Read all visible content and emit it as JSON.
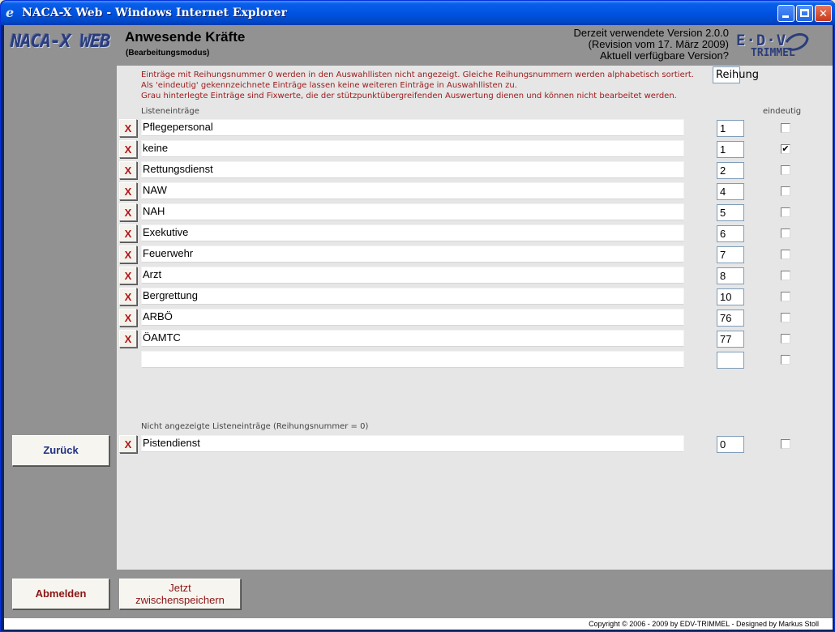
{
  "window": {
    "title": "NACA-X Web - Windows Internet Explorer",
    "icon": "ie-icon"
  },
  "header": {
    "logo": "NACA-X WEB",
    "title": "Anwesende Kräfte",
    "subtitle": "(Bearbeitungsmodus)",
    "version_line1": "Derzeit verwendete Version 2.0.0",
    "version_line2": "(Revision vom 17. März 2009)",
    "version_line3": "Aktuell verfügbare Version?",
    "brand_main": "E·D·V",
    "brand_sub": "TRIMMEL"
  },
  "info": {
    "line1": "Einträge mit Reihungsnummer 0 werden in den Auswahllisten nicht angezeigt. Gleiche Reihungsnummern werden alphabetisch sortiert.",
    "line2": "Als 'eindeutig' gekennzeichnete Einträge lassen keine weiteren Einträge in Auswahllisten zu.",
    "line3": "Grau hinterlegte Einträge sind Fixwerte, die der stützpunktübergreifenden Auswertung dienen und können nicht bearbeitet werden."
  },
  "columns": {
    "list": "Listeneinträge",
    "rank": "Reihung",
    "unique": "eindeutig"
  },
  "delete_label": "X",
  "entries": [
    {
      "name": "Pflegepersonal",
      "rank": "1",
      "unique": false
    },
    {
      "name": "keine",
      "rank": "1",
      "unique": true
    },
    {
      "name": "Rettungsdienst",
      "rank": "2",
      "unique": false
    },
    {
      "name": "NAW",
      "rank": "4",
      "unique": false
    },
    {
      "name": "NAH",
      "rank": "5",
      "unique": false
    },
    {
      "name": "Exekutive",
      "rank": "6",
      "unique": false
    },
    {
      "name": "Feuerwehr",
      "rank": "7",
      "unique": false
    },
    {
      "name": "Arzt",
      "rank": "8",
      "unique": false
    },
    {
      "name": "Bergrettung",
      "rank": "10",
      "unique": false
    },
    {
      "name": "ARBÖ",
      "rank": "76",
      "unique": false
    },
    {
      "name": "ÖAMTC",
      "rank": "77",
      "unique": false
    }
  ],
  "new_entry": {
    "name": "",
    "rank": "",
    "unique": false
  },
  "hidden_section": {
    "label": "Nicht angezeigte Listeneinträge (Reihungsnummer = 0)",
    "entries": [
      {
        "name": "Pistendienst",
        "rank": "0",
        "unique": false
      }
    ]
  },
  "buttons": {
    "back": "Zurück",
    "logout": "Abmelden",
    "save_line1": "Jetzt",
    "save_line2": "zwischenspeichern"
  },
  "footer": {
    "copyright": "Copyright © 2006 - 2009 by EDV-TRIMMEL - Designed by Markus Stoll"
  }
}
